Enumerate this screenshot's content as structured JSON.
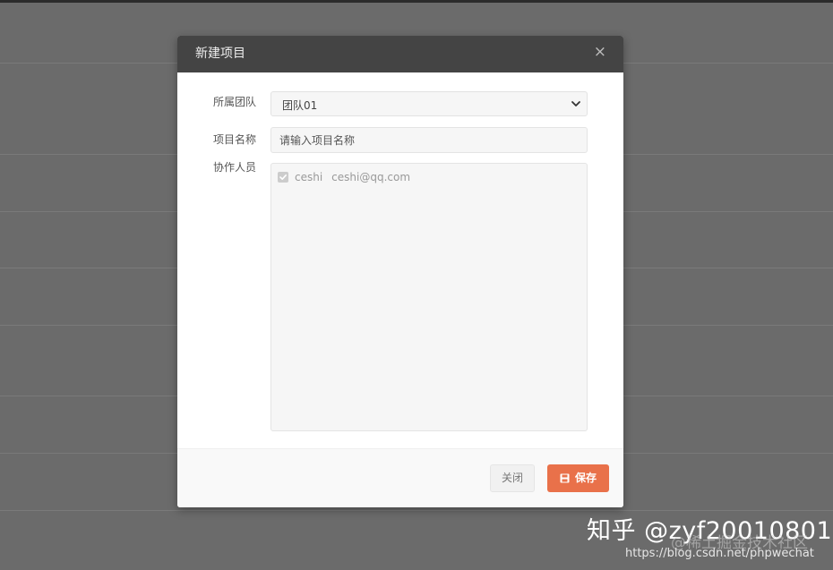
{
  "modal": {
    "title": "新建项目",
    "close_icon": "close-icon",
    "fields": {
      "team_label": "所属团队",
      "team_value": "团队01",
      "project_name_label": "项目名称",
      "project_name_placeholder": "请输入项目名称",
      "project_name_value": "",
      "collaborators_label": "协作人员"
    },
    "collaborators": [
      {
        "name": "ceshi",
        "email": "ceshi@qq.com",
        "checked": true
      }
    ],
    "footer": {
      "close_label": "关闭",
      "save_label": "保存",
      "save_icon": "save-icon"
    }
  },
  "watermark": {
    "main": "知乎 @zyf20010801",
    "sub": "@稀土掘金技术社区",
    "url": "https://blog.csdn.net/phpwechat"
  },
  "colors": {
    "overlay": "#6b6b6b",
    "header": "#444444",
    "accent": "#e9714a",
    "field_bg": "#f6f6f6"
  }
}
